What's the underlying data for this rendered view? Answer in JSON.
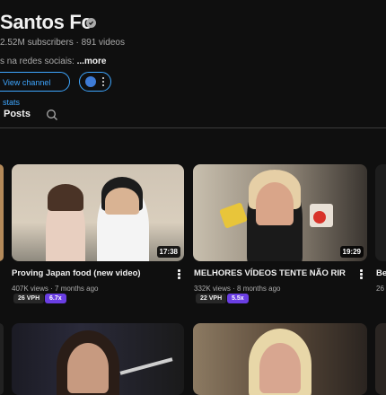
{
  "channel": {
    "name": "Santos Fc",
    "meta": "2.52M subscribers · 891 videos",
    "social_text": "s na redes sociais:",
    "more_label": "...more",
    "stats_button": "View channel stats"
  },
  "tabs": {
    "posts": "Posts"
  },
  "videos": [
    {
      "title": "Proving Japan food (new video)",
      "meta": "407K views · 7 months ago",
      "duration": "17:38",
      "vph": "26 VPH",
      "multiplier": "6.7x"
    },
    {
      "title": "MELHORES VÍDEOS TENTE NÃO RIR",
      "meta": "332K views · 8 months ago",
      "duration": "19:29",
      "vph": "22 VPH",
      "multiplier": "5.5x"
    },
    {
      "title": "Be",
      "meta": "26"
    }
  ],
  "colors": {
    "background": "#0f0f0f",
    "accent_blue": "#3ea6ff",
    "multiplier_purple": "#6a3ee3"
  }
}
